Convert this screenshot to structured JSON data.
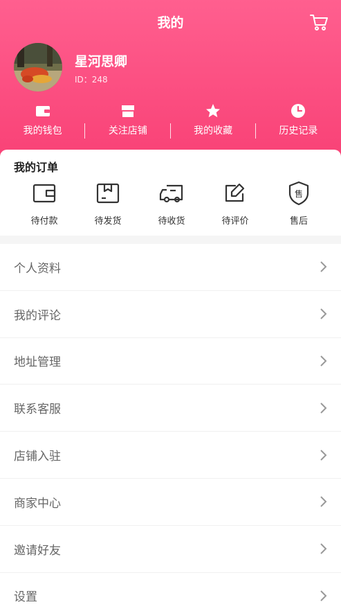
{
  "header": {
    "title": "我的",
    "bg_color": "#fb4d80"
  },
  "profile": {
    "name": "星河思卿",
    "id_label": "ID：248"
  },
  "quick_links": [
    {
      "label": "我的钱包",
      "icon": "wallet-icon"
    },
    {
      "label": "关注店铺",
      "icon": "store-icon"
    },
    {
      "label": "我的收藏",
      "icon": "star-icon"
    },
    {
      "label": "历史记录",
      "icon": "clock-icon"
    }
  ],
  "orders": {
    "title": "我的订单",
    "items": [
      {
        "label": "待付款",
        "icon": "wallet-outline-icon"
      },
      {
        "label": "待发货",
        "icon": "package-icon"
      },
      {
        "label": "待收货",
        "icon": "truck-icon"
      },
      {
        "label": "待评价",
        "icon": "edit-icon"
      },
      {
        "label": "售后",
        "icon": "after-sales-shield-icon"
      }
    ]
  },
  "menu": [
    {
      "label": "个人资料"
    },
    {
      "label": "我的评论"
    },
    {
      "label": "地址管理"
    },
    {
      "label": "联系客服"
    },
    {
      "label": "店铺入驻"
    },
    {
      "label": "商家中心"
    },
    {
      "label": "邀请好友"
    },
    {
      "label": "设置"
    }
  ]
}
